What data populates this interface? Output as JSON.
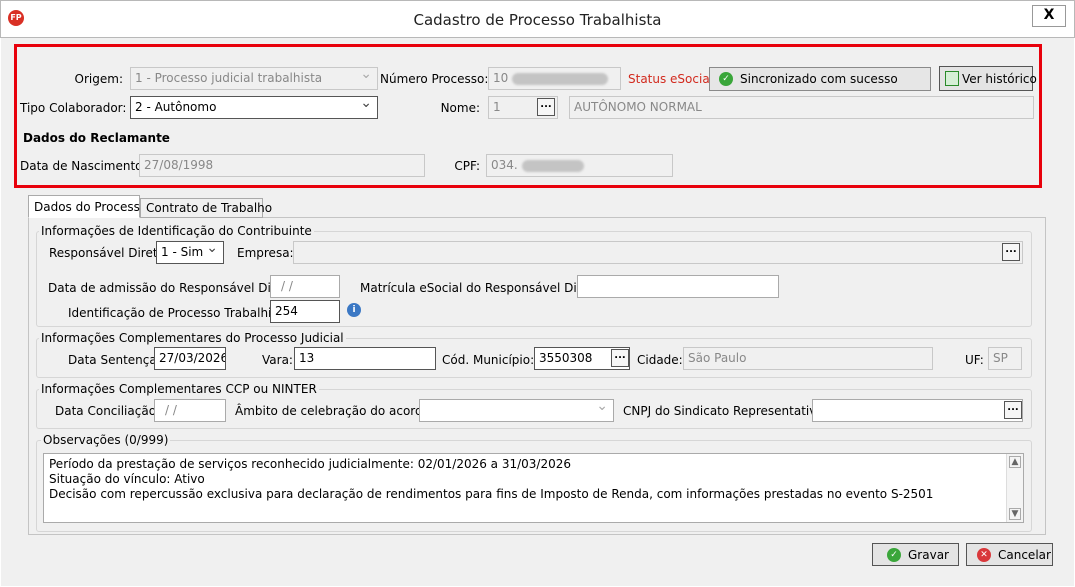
{
  "window": {
    "title": "Cadastro de Processo Trabalhista",
    "app_icon": "FP",
    "close": "X"
  },
  "header": {
    "origem_label": "Origem:",
    "origem_value": "1 - Processo judicial trabalhista",
    "numero_label": "Número Processo:",
    "numero_value": "10",
    "status_label": "Status eSocial:",
    "status_value": "Sincronizado com sucesso",
    "historico_button": "Ver histórico",
    "tipo_label": "Tipo Colaborador:",
    "tipo_value": "2 - Autônomo",
    "nome_label": "Nome:",
    "nome_code": "1",
    "nome_value": "AUTÔNOMO NORMAL",
    "reclamante_heading": "Dados do Reclamante",
    "nascimento_label": "Data de Nascimento:",
    "nascimento_value": "27/08/1998",
    "cpf_label": "CPF:",
    "cpf_value": "034."
  },
  "tabs": [
    {
      "label": "Dados do Processo",
      "active": true
    },
    {
      "label": "Contrato de Trabalho",
      "active": false
    }
  ],
  "identificacao": {
    "title": "Informações de Identificação do Contribuinte",
    "responsavel_label": "Responsável Direto:",
    "responsavel_value": "1 - Sim",
    "empresa_label": "Empresa:",
    "empresa_value": "",
    "admissao_label": "Data de admissão do Responsável Direto:",
    "admissao_value": "/ /",
    "matricula_label": "Matrícula eSocial do Responsável Direto",
    "matricula_value": "",
    "id_processo_label": "Identificação de Processo Trabalhista:",
    "id_processo_value": "254"
  },
  "judicial": {
    "title": "Informações Complementares do Processo Judicial",
    "sentenca_label": "Data Sentença:",
    "sentenca_value": "27/03/2026",
    "vara_label": "Vara:",
    "vara_value": "13",
    "municipio_label": "Cód. Município:",
    "municipio_value": "3550308",
    "cidade_label": "Cidade:",
    "cidade_value": "São Paulo",
    "uf_label": "UF:",
    "uf_value": "SP"
  },
  "ccp": {
    "title": "Informações Complementares CCP ou NINTER",
    "conciliacao_label": "Data Conciliação:",
    "conciliacao_value": "/ /",
    "ambito_label": "Âmbito de celebração do acordo:",
    "ambito_value": "",
    "cnpj_label": "CNPJ do Sindicato Representativo:",
    "cnpj_value": ""
  },
  "observacoes": {
    "title": "Observações (0/999)",
    "lines": [
      "Período da prestação de serviços reconhecido judicialmente: 02/01/2026 a 31/03/2026",
      "Situação do vínculo: Ativo",
      "Decisão com repercussão exclusiva para declaração de rendimentos para fins de Imposto de Renda, com informações prestadas no evento S-2501"
    ]
  },
  "footer": {
    "gravar": "Gravar",
    "cancelar": "Cancelar"
  },
  "colors": {
    "status_label": "#d22a1e",
    "highlight_border": "#e8000b",
    "ok_icon": "#3aa63a",
    "cancel_icon": "#d9383b"
  }
}
